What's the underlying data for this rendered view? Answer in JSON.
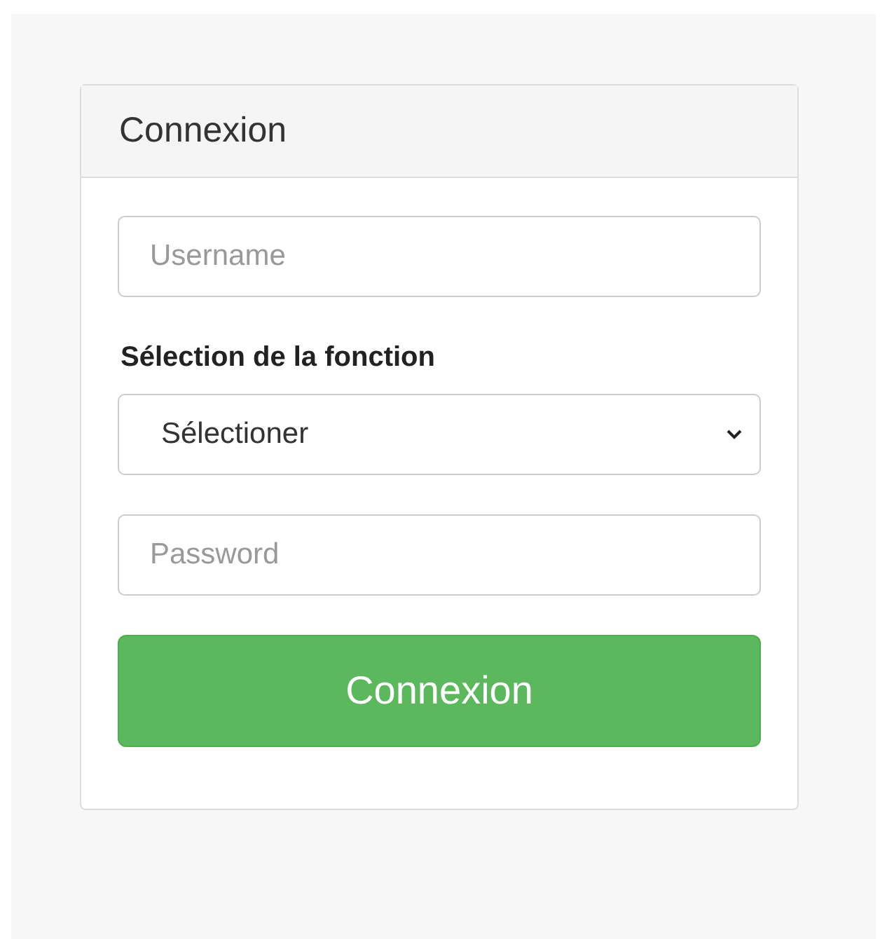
{
  "card": {
    "title": "Connexion"
  },
  "username": {
    "placeholder": "Username"
  },
  "role": {
    "label": "Sélection de la fonction",
    "value": "Sélectioner"
  },
  "password": {
    "placeholder": "Password"
  },
  "submit": {
    "label": "Connexion"
  }
}
